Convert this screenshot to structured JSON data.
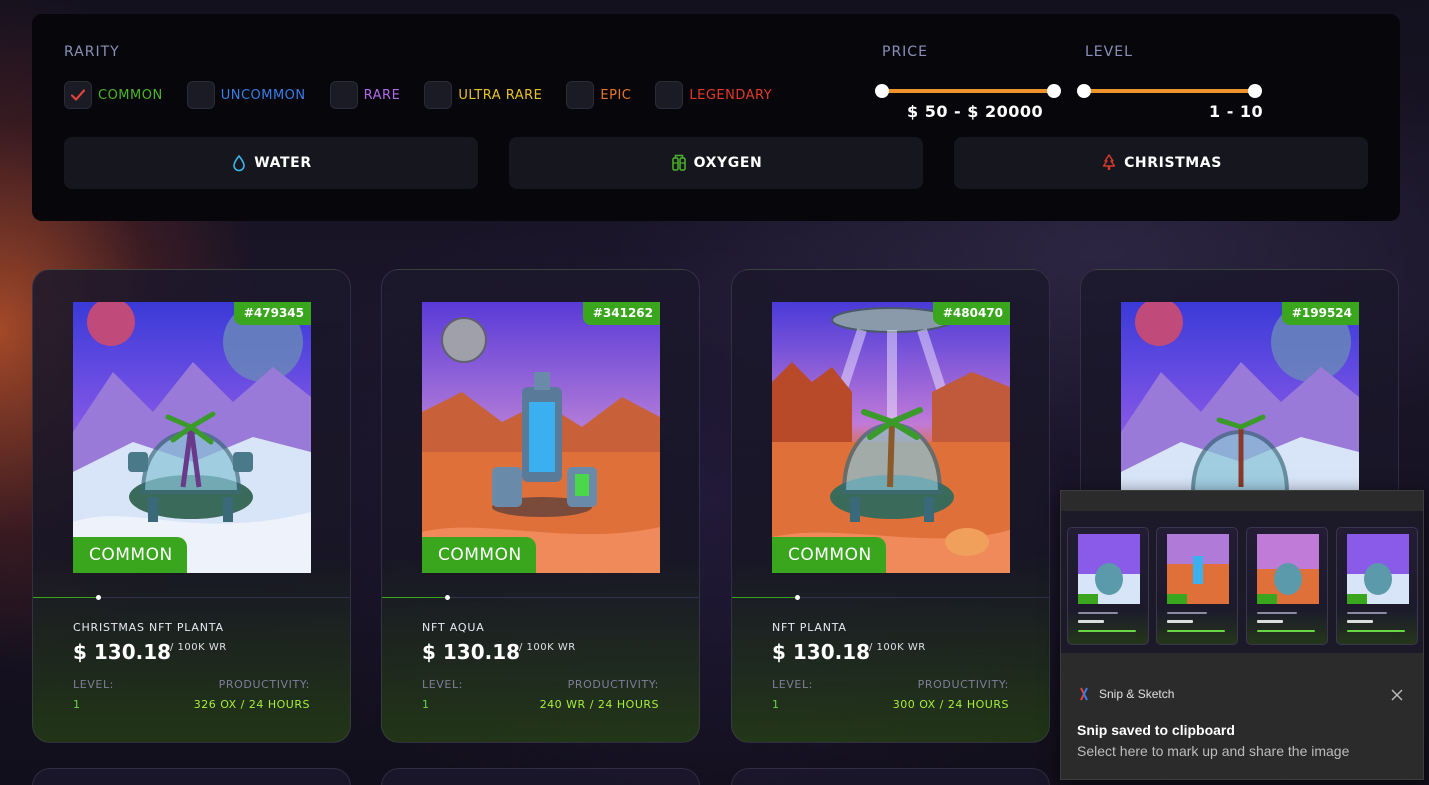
{
  "filters": {
    "rarity_title": "RARITY",
    "rarities": [
      {
        "label": "COMMON",
        "checked": true,
        "color": "#4bb52a"
      },
      {
        "label": "UNCOMMON",
        "checked": false,
        "color": "#3b7de8"
      },
      {
        "label": "RARE",
        "checked": false,
        "color": "#b06ae8"
      },
      {
        "label": "ULTRA RARE",
        "checked": false,
        "color": "#e8c22a"
      },
      {
        "label": "EPIC",
        "checked": false,
        "color": "#e8762a"
      },
      {
        "label": "LEGENDARY",
        "checked": false,
        "color": "#e33a2a"
      }
    ],
    "price_title": "PRICE",
    "price_value": "$ 50 - $ 20000",
    "level_title": "LEVEL",
    "level_value": "1 - 10",
    "types": [
      {
        "label": "WATER",
        "icon": "water-drop-icon",
        "color": "#3ab6e6"
      },
      {
        "label": "OXYGEN",
        "icon": "oxygen-tank-icon",
        "color": "#4bb52a"
      },
      {
        "label": "CHRISTMAS",
        "icon": "christmas-tree-icon",
        "color": "#d53a2a"
      }
    ],
    "slider_color": "#f0932f"
  },
  "cards": [
    {
      "id": "#479345",
      "rarity": "COMMON",
      "name": "CHRISTMAS NFT PLANTA",
      "price": "$ 130.18",
      "unit": "/ 100K WR",
      "level_label": "LEVEL:",
      "level": "1",
      "productivity_label": "PRODUCTIVITY:",
      "productivity": "326 OX / 24 HOURS"
    },
    {
      "id": "#341262",
      "rarity": "COMMON",
      "name": "NFT AQUA",
      "price": "$ 130.18",
      "unit": "/ 100K WR",
      "level_label": "LEVEL:",
      "level": "1",
      "productivity_label": "PRODUCTIVITY:",
      "productivity": "240 WR / 24 HOURS"
    },
    {
      "id": "#480470",
      "rarity": "COMMON",
      "name": "NFT PLANTA",
      "price": "$ 130.18",
      "unit": "/ 100K WR",
      "level_label": "LEVEL:",
      "level": "1",
      "productivity_label": "PRODUCTIVITY:",
      "productivity": "300 OX / 24 HOURS"
    },
    {
      "id": "#199524",
      "rarity": "COMMON",
      "name": "",
      "price": "",
      "unit": "",
      "level_label": "",
      "level": "",
      "productivity_label": "",
      "productivity": ""
    }
  ],
  "snip": {
    "app_name": "Snip & Sketch",
    "title": "Snip saved to clipboard",
    "body": "Select here to mark up and share the image"
  },
  "accent_green": "#3aa61e"
}
